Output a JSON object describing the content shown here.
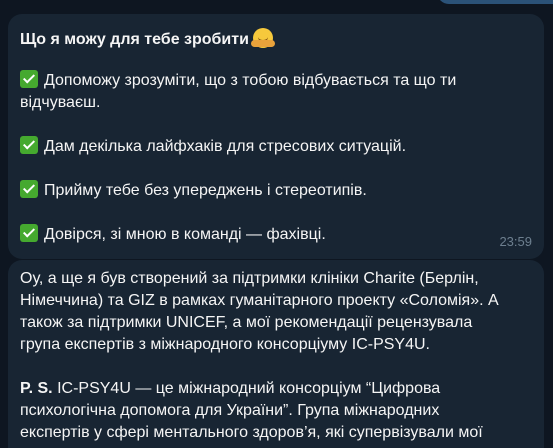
{
  "messages": [
    {
      "title": "Що я можу для тебе зробити",
      "title_emoji": "hugging-face-emoji",
      "items": [
        {
          "line1": "Допоможу зрозуміти, що з тобою відбувається та що ти",
          "line2": "відчуваєш."
        },
        {
          "line1": "Дам декілька лайфхаків для стресових ситуацій."
        },
        {
          "line1": "Прийму тебе без упереджень і стереотипів."
        },
        {
          "line1": "Довірся, зі мною в команді — фахівці."
        }
      ],
      "time": "23:59"
    },
    {
      "paragraph1": [
        "Оу, а ще я був створений за підтримки клініки Charite (Берлін,",
        "Німеччина) та GIZ в рамках гуманітарного проекту «Соломія». А",
        "також за підтримки UNICEF, а мої рекомендації рецензувала",
        "група експертів з міжнародного консорціуму IC-PSY4U."
      ],
      "ps_label": "P. S.",
      "paragraph2": [
        "IC-PSY4U — це міжнародний консорціум “Цифрова",
        "психологічна допомога для України”. Група міжнародних",
        "експертів у сфері ментального здоров’я, які супервізували мої"
      ]
    }
  ],
  "colors": {
    "background": "#0e1621",
    "bubble_incoming": "#182533",
    "bubble_outgoing": "#2b5278",
    "check_green": "#45a92f",
    "timestamp": "#6d7f8f"
  }
}
